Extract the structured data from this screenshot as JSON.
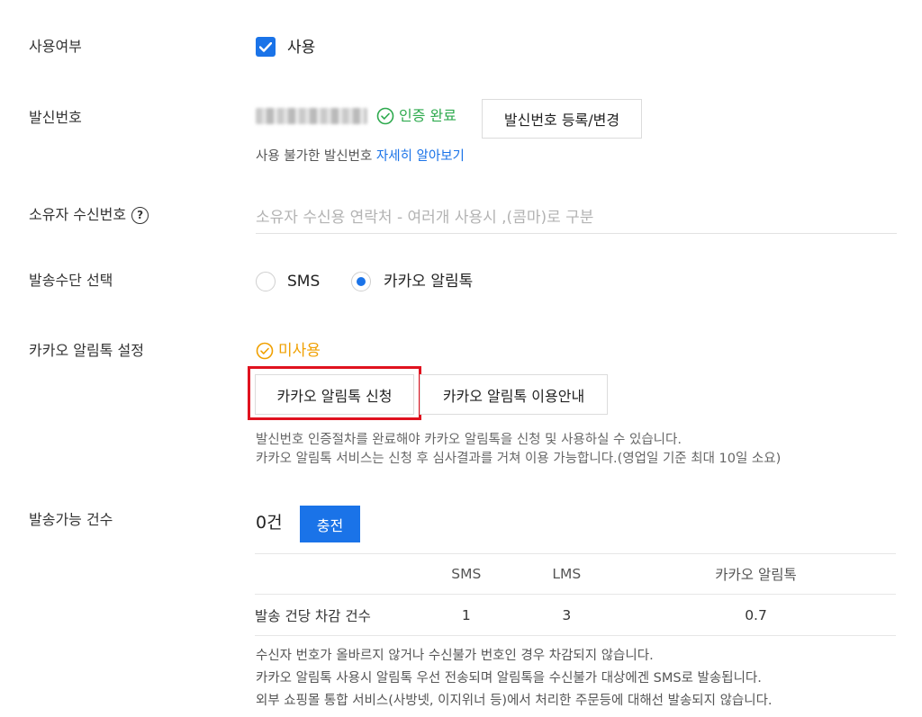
{
  "rows": {
    "usage": {
      "label": "사용여부",
      "checkbox_label": "사용"
    },
    "sender": {
      "label": "발신번호",
      "verified_text": "인증 완료",
      "register_button": "발신번호 등록/변경",
      "help_prefix": "사용 불가한 발신번호",
      "help_link": "자세히 알아보기"
    },
    "owner": {
      "label": "소유자 수신번호",
      "placeholder": "소유자 수신용 연락처 - 여러개 사용시 ,(콤마)로 구분"
    },
    "method": {
      "label": "발송수단 선택",
      "options": [
        "SMS",
        "카카오 알림톡"
      ],
      "selected": "카카오 알림톡"
    },
    "kakao": {
      "label": "카카오 알림톡 설정",
      "status": "미사용",
      "apply_button": "카카오 알림톡 신청",
      "guide_button": "카카오 알림톡 이용안내",
      "notes": [
        "발신번호 인증절차를 완료해야 카카오 알림톡을 신청 및 사용하실 수 있습니다.",
        "카카오 알림톡 서비스는 신청 후 심사결과를 거쳐 이용 가능합니다.(영업일 기준 최대 10일 소요)"
      ]
    },
    "quota": {
      "label": "발송가능 건수",
      "count": "0건",
      "charge_button": "충전",
      "table": {
        "headers": [
          "",
          "SMS",
          "LMS",
          "카카오 알림톡"
        ],
        "rows": [
          [
            "발송 건당 차감 건수",
            "1",
            "3",
            "0.7"
          ]
        ]
      },
      "notes": [
        "수신자 번호가 올바르지 않거나 수신불가 번호인 경우 차감되지 않습니다.",
        "카카오 알림톡 사용시 알림톡 우선 전송되며 알림톡을 수신불가 대상에겐 SMS로 발송됩니다.",
        "외부 쇼핑몰 통합 서비스(사방넷, 이지위너 등)에서 처리한 주문등에 대해선 발송되지 않습니다."
      ]
    }
  },
  "colors": {
    "accent": "#1a73e8",
    "success": "#2eaa4e",
    "warning": "#f0a000",
    "highlight": "#e0121f"
  }
}
